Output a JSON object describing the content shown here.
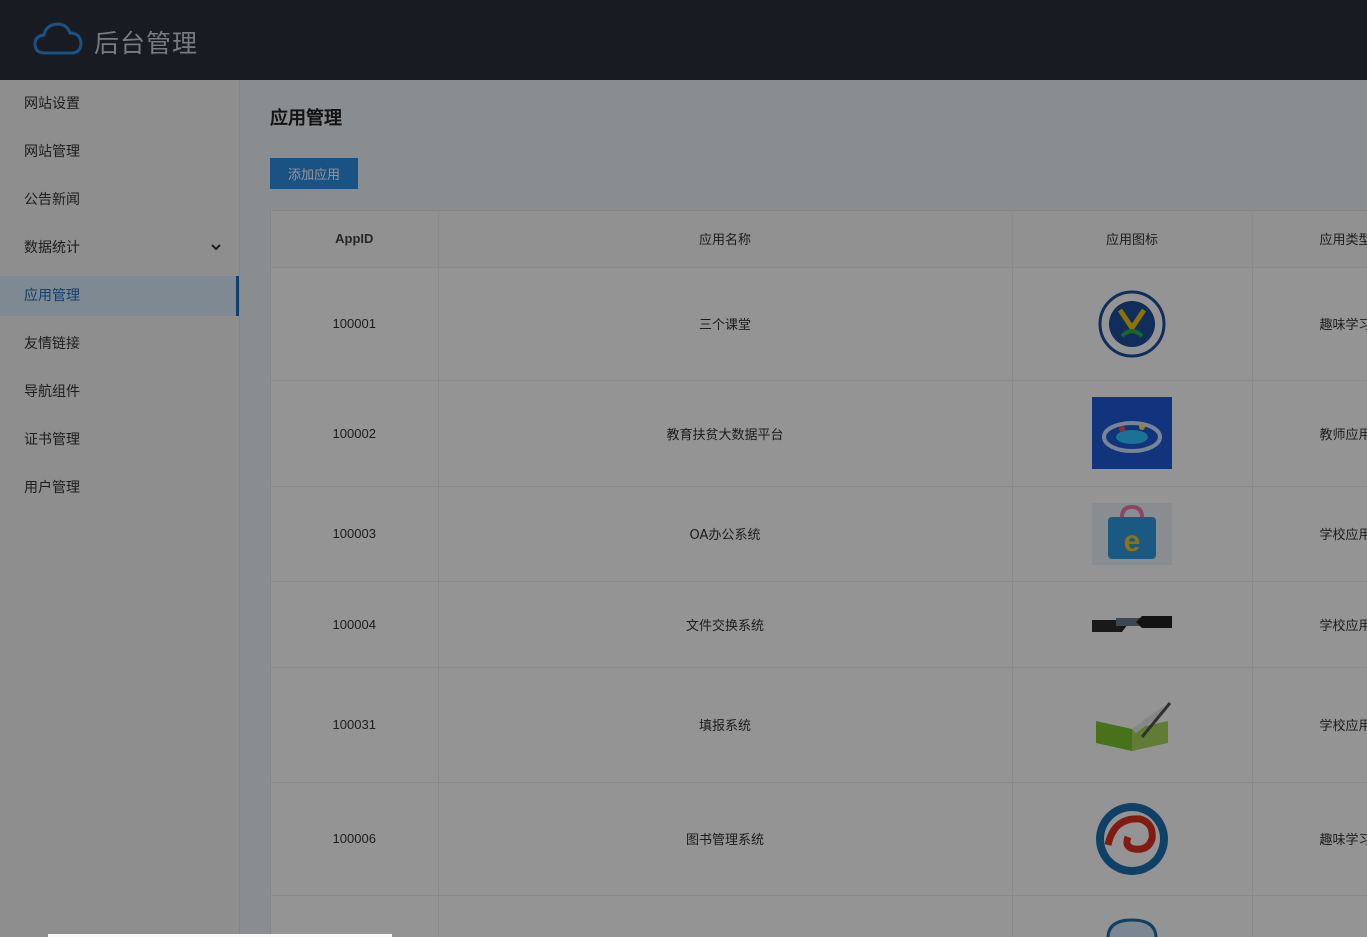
{
  "header": {
    "title": "后台管理",
    "logo_icon": "cloud-icon"
  },
  "sidebar": {
    "items": [
      {
        "label": "网站设置"
      },
      {
        "label": "网站管理"
      },
      {
        "label": "公告新闻"
      },
      {
        "label": "数据统计",
        "has_submenu": true
      },
      {
        "label": "应用管理",
        "active": true
      },
      {
        "label": "友情链接"
      },
      {
        "label": "导航组件"
      },
      {
        "label": "证书管理"
      },
      {
        "label": "用户管理"
      }
    ]
  },
  "main": {
    "title": "应用管理",
    "add_button": "添加应用",
    "table": {
      "columns": [
        "AppID",
        "应用名称",
        "应用图标",
        "应用类型"
      ],
      "rows": [
        {
          "id": "100001",
          "name": "三个课堂",
          "icon": "school-badge-icon",
          "type": "趣味学习"
        },
        {
          "id": "100002",
          "name": "教育扶贫大数据平台",
          "icon": "data-platform-icon",
          "type": "教师应用"
        },
        {
          "id": "100003",
          "name": "OA办公系统",
          "icon": "oa-bag-icon",
          "type": "学校应用"
        },
        {
          "id": "100004",
          "name": "文件交换系统",
          "icon": "file-exchange-icon",
          "type": "学校应用"
        },
        {
          "id": "100031",
          "name": "填报系统",
          "icon": "book-pen-icon",
          "type": "学校应用"
        },
        {
          "id": "100006",
          "name": "图书管理系统",
          "icon": "swirl-logo-icon",
          "type": "趣味学习"
        }
      ]
    }
  },
  "colors": {
    "header_bg": "#2c303b",
    "accent": "#2f8de4",
    "overlay": "rgba(0,0,0,0.42)"
  }
}
